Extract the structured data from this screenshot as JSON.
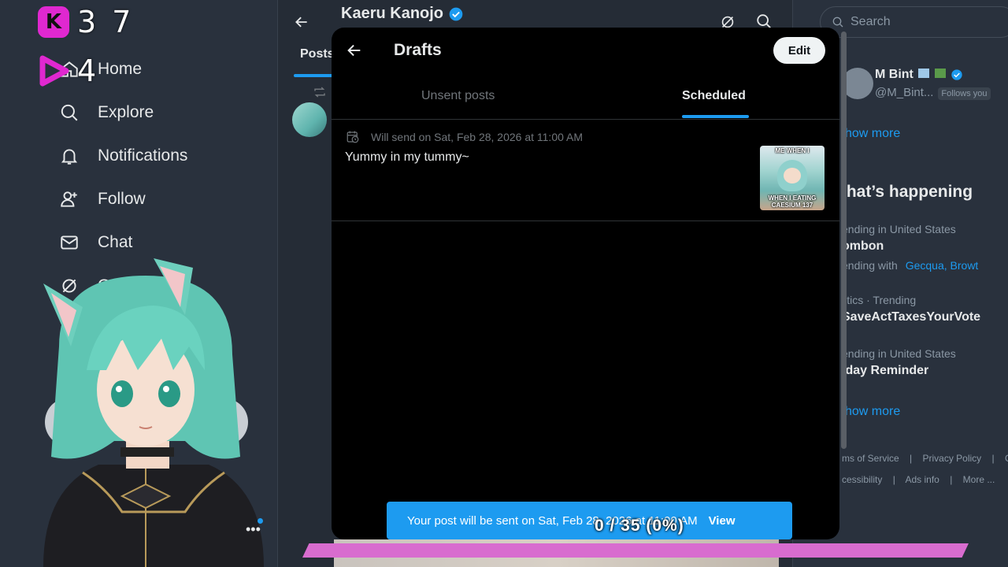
{
  "overlay": {
    "kill_count": "3 7",
    "play_count": "4"
  },
  "sidebar": {
    "items": [
      {
        "label": "Home",
        "icon": "home-icon"
      },
      {
        "label": "Explore",
        "icon": "search-icon"
      },
      {
        "label": "Notifications",
        "icon": "bell-icon"
      },
      {
        "label": "Follow",
        "icon": "follow-icon"
      },
      {
        "label": "Chat",
        "icon": "mail-icon"
      },
      {
        "label": "Grok",
        "icon": "grok-icon"
      }
    ]
  },
  "profile": {
    "name": "Kaeru Kanojo",
    "tab_posts": "Posts"
  },
  "drafts": {
    "title": "Drafts",
    "edit_label": "Edit",
    "tabs": [
      "Unsent posts",
      "Scheduled"
    ],
    "active_tab": "Scheduled",
    "scheduled_post": {
      "schedule_text": "Will send on Sat, Feb 28, 2026 at 11:00 AM",
      "text": "Yummy in my tummy~",
      "thumb_caption_top": "ME WHEN I",
      "thumb_caption_bottom": "WHEN I EATING CAESIUM 137"
    }
  },
  "toast": {
    "message": "Your post will be sent on Sat, Feb 28, 2026 at 11:00 AM",
    "action": "View"
  },
  "goal": {
    "text": "0 / 35 (0%)"
  },
  "right_sidebar": {
    "search_placeholder": "Search",
    "who_to_follow": {
      "name": "M Bint",
      "handle": "@M_Bint...",
      "badge": "Follows you",
      "show_more": "how more"
    },
    "whats_happening": {
      "heading": "/hat’s happening",
      "trends": [
        {
          "context": "ending in United States",
          "title": "ombon"
        },
        {
          "context": "ending with",
          "title": "",
          "links": "Gecqua, Browt"
        },
        {
          "context": "litics · Trending",
          "title": "SaveActTaxesYourVote"
        },
        {
          "context": "ending in United States",
          "title": "iday Reminder"
        }
      ],
      "show_more": "how more"
    },
    "footer": {
      "line1": [
        "ms of Service",
        "Privacy Policy",
        "C"
      ],
      "line2": [
        "cessibility",
        "Ads info",
        "More ..."
      ]
    }
  },
  "colors": {
    "accent": "#1d9bf0",
    "goal_bar": "#d86ccf",
    "overlay_badge": "#e028d0"
  }
}
